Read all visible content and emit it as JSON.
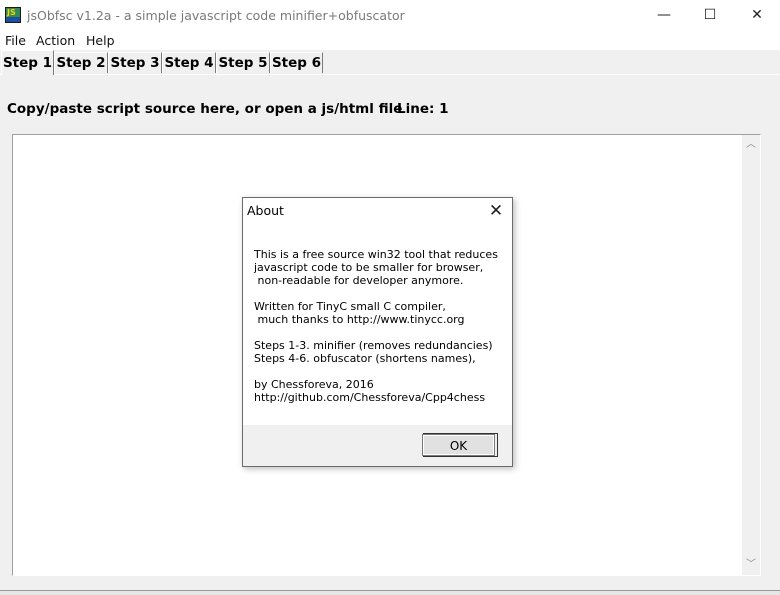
{
  "window": {
    "title": "jsObfsc v1.2a - a simple javascript code minifier+obfuscator",
    "controls": {
      "minimize": "—",
      "maximize": "☐",
      "close": "✕"
    }
  },
  "menu": {
    "items": [
      {
        "label": "File"
      },
      {
        "label": "Action"
      },
      {
        "label": "Help"
      }
    ]
  },
  "tabs": [
    {
      "label": "Step 1",
      "active": true
    },
    {
      "label": "Step 2",
      "active": false
    },
    {
      "label": "Step 3",
      "active": false
    },
    {
      "label": "Step 4",
      "active": false
    },
    {
      "label": "Step 5",
      "active": false
    },
    {
      "label": "Step 6",
      "active": false
    }
  ],
  "editor": {
    "prompt": "Copy/paste script source here,  or open a js/html file",
    "line_indicator": "Line: 1",
    "content": ""
  },
  "about_dialog": {
    "title": "About",
    "close_glyph": "✕",
    "body": "This is a free source win32 tool that reduces\njavascript code to be smaller for browser,\n non-readable for developer anymore.\n\nWritten for TinyC small C compiler,\n much thanks to http://www.tinycc.org\n\nSteps 1-3. minifier (removes redundancies)\nSteps 4-6. obfuscator (shortens names),\n\nby Chessforeva, 2016\nhttp://github.com/Chessforeva/Cpp4chess",
    "ok_label": "OK"
  }
}
